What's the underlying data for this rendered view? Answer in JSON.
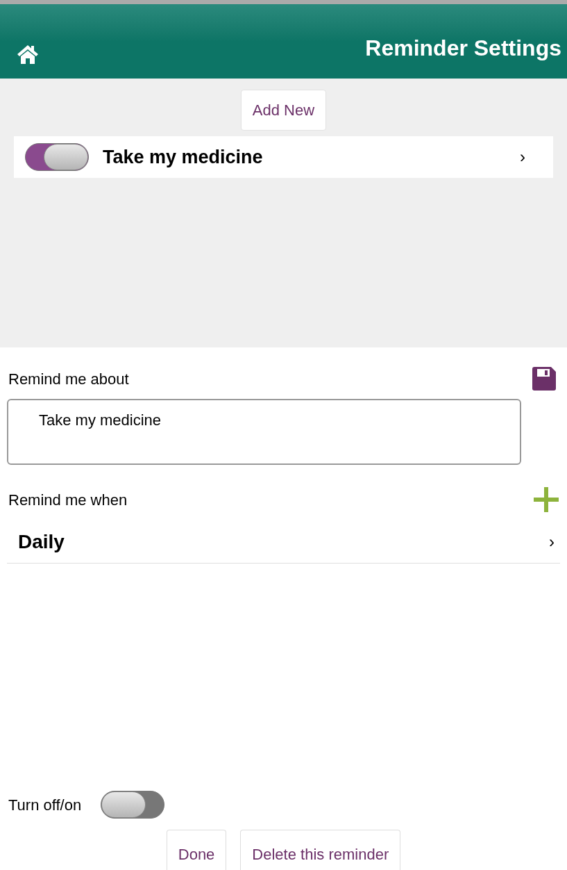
{
  "header": {
    "title": "Reminder Settings"
  },
  "add_button": "Add New",
  "reminders": [
    {
      "label": "Take my medicine",
      "on": true,
      "chevron": "›"
    }
  ],
  "about": {
    "label": "Remind me about",
    "value": "Take my medicine"
  },
  "when": {
    "label": "Remind me when",
    "items": [
      {
        "label": "Daily",
        "chevron": "›"
      }
    ]
  },
  "toggle": {
    "label": "Turn off/on",
    "on": false
  },
  "buttons": [
    "Done",
    "Delete this reminder"
  ]
}
